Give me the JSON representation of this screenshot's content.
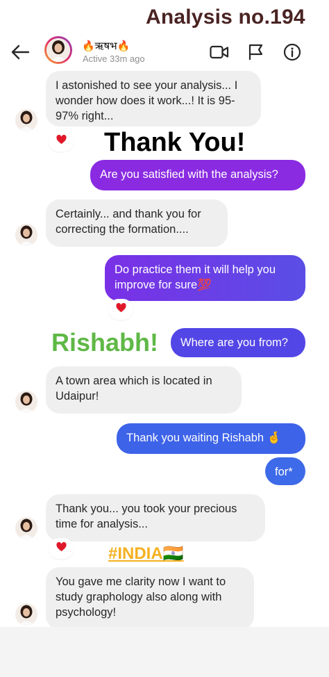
{
  "overlay": {
    "title": "Analysis no.194"
  },
  "header": {
    "contact_name": "🔥ऋषभ🔥",
    "status": "Active 33m ago",
    "icons": [
      "back-arrow-icon",
      "video-call-icon",
      "flag-icon",
      "info-icon"
    ]
  },
  "messages": [
    {
      "from": "them",
      "text": "I astonished to see your analysis... I wonder how does it work...! It is 95-97% right...",
      "reaction": "heart"
    },
    {
      "from": "me",
      "text": "Are you satisfied with the analysis?"
    },
    {
      "from": "them",
      "text": "Certainly... and thank you for correcting the formation...."
    },
    {
      "from": "me",
      "text": "Do practice them it will help you improve for sure💯",
      "reaction": "heart"
    },
    {
      "from": "me",
      "text": "Where are you from?"
    },
    {
      "from": "them",
      "text": "A town area which is located in Udaipur!"
    },
    {
      "from": "me",
      "text": "Thank you waiting Rishabh 🤞"
    },
    {
      "from": "me",
      "text": "for*"
    },
    {
      "from": "them",
      "text": "Thank you... you took your precious time for analysis...",
      "reaction": "heart"
    },
    {
      "from": "them",
      "text": "You gave me clarity now I want to study graphology also along with psychology!"
    }
  ],
  "annotations": {
    "thank_you": "Thank You!",
    "rishabh": "Rishabh!",
    "india": "#INDIA🇮🇳"
  },
  "colors": {
    "overlay_title": "#4a2323",
    "thank_you": "#e0121b",
    "rishabh": "#5fb846",
    "india": "#f5b120",
    "bubble_purple": "#8a2be2",
    "bubble_blue": "#3d63e8",
    "bubble_gray": "#efefef"
  }
}
